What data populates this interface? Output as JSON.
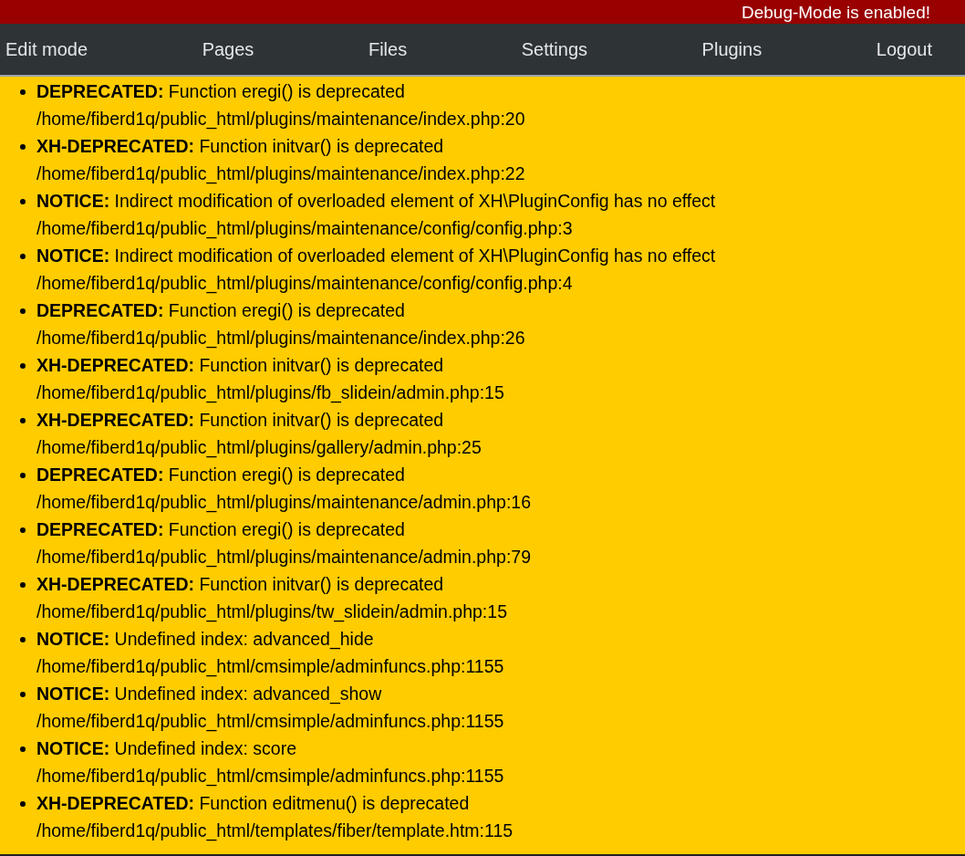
{
  "debug_banner": "Debug-Mode is enabled!",
  "nav": [
    "Edit mode",
    "Pages",
    "Files",
    "Settings",
    "Plugins",
    "Logout"
  ],
  "messages": [
    {
      "text": "**DEPRECATED:** Function eregi() is deprecated",
      "location": "/home/fiberd1q/public_html/plugins/maintenance/index.php:20"
    },
    {
      "text": "**XH-DEPRECATED:** Function initvar() is deprecated",
      "location": "/home/fiberd1q/public_html/plugins/maintenance/index.php:22"
    },
    {
      "text": "**NOTICE:** Indirect modification of overloaded element of XH\\PluginConfig has no effect",
      "location": "/home/fiberd1q/public_html/plugins/maintenance/config/config.php:3"
    },
    {
      "text": "**NOTICE:** Indirect modification of overloaded element of XH\\PluginConfig has no effect",
      "location": "/home/fiberd1q/public_html/plugins/maintenance/config/config.php:4"
    },
    {
      "text": "**DEPRECATED:** Function eregi() is deprecated",
      "location": "/home/fiberd1q/public_html/plugins/maintenance/index.php:26"
    },
    {
      "text": "**XH-DEPRECATED:** Function initvar() is deprecated",
      "location": "/home/fiberd1q/public_html/plugins/fb_slidein/admin.php:15"
    },
    {
      "text": "**XH-DEPRECATED:** Function initvar() is deprecated",
      "location": "/home/fiberd1q/public_html/plugins/gallery/admin.php:25"
    },
    {
      "text": "**DEPRECATED:** Function eregi() is deprecated",
      "location": "/home/fiberd1q/public_html/plugins/maintenance/admin.php:16"
    },
    {
      "text": "**DEPRECATED:** Function eregi() is deprecated",
      "location": "/home/fiberd1q/public_html/plugins/maintenance/admin.php:79"
    },
    {
      "text": "**XH-DEPRECATED:** Function initvar() is deprecated",
      "location": "/home/fiberd1q/public_html/plugins/tw_slidein/admin.php:15"
    },
    {
      "text": "**NOTICE:** Undefined index: advanced_hide",
      "location": "/home/fiberd1q/public_html/cmsimple/adminfuncs.php:1155"
    },
    {
      "text": "**NOTICE:** Undefined index: advanced_show",
      "location": "/home/fiberd1q/public_html/cmsimple/adminfuncs.php:1155"
    },
    {
      "text": "**NOTICE:** Undefined index: score",
      "location": "/home/fiberd1q/public_html/cmsimple/adminfuncs.php:1155"
    },
    {
      "text": "**XH-DEPRECATED:** Function editmenu() is deprecated",
      "location": "/home/fiberd1q/public_html/templates/fiber/template.htm:115"
    }
  ]
}
